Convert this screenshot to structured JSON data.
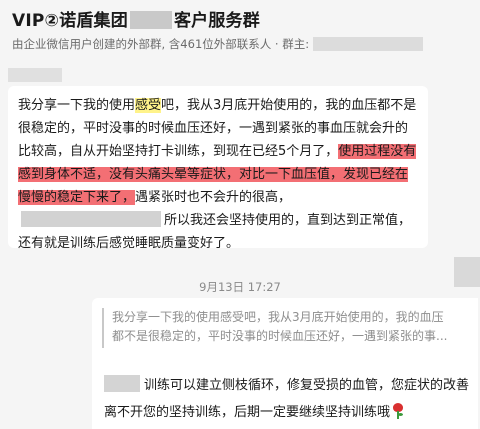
{
  "header": {
    "title_prefix": "VIP②诺盾集团",
    "title_suffix": "客户服务群",
    "subtitle": "由企业微信用户创建的外部群, 含461位外部联系人 · 群主:"
  },
  "message1": {
    "segments": [
      {
        "text": "我分享一下我的使用",
        "style": "plain"
      },
      {
        "text": "感受",
        "style": "yellow"
      },
      {
        "text": "吧，我从3月底开始使用的，我的血压都不是很稳定的，平时没事的时候血压还好，一遇到紧张的事血压就会升的比较高，自从开始坚持打卡训练，到现在已经5个月了，",
        "style": "plain"
      },
      {
        "text": "使用过程没有感到身体不适，没有头痛头晕等症状，对比一下血压值，发现已经在慢慢的稳定下来了，",
        "style": "red"
      },
      {
        "text": "遇紧张时也不会升的很高，",
        "style": "plain"
      },
      {
        "text": "所以我还会坚持使用的，直到达到正常值，还有就是训练后感觉睡眠质量变好了。",
        "style": "plain"
      }
    ]
  },
  "timestamp": "9月13日 17:27",
  "reply": {
    "quote_line1": "我分享一下我的使用感受吧，我从3月底开始使用的，我的血压",
    "quote_line2": "都不是很稳定的，平时没事的时候血压还好，一遇到紧张的事...",
    "text": "训练可以建立侧枝循环，修复受损的血管，您症状的改善离不开您的坚持训练，后期一定要继续坚持训练哦",
    "emoji_icon": "rose-icon"
  },
  "colors": {
    "highlight_yellow": "#fff38a",
    "highlight_red": "#f36f74",
    "background": "#f5f5f5"
  }
}
